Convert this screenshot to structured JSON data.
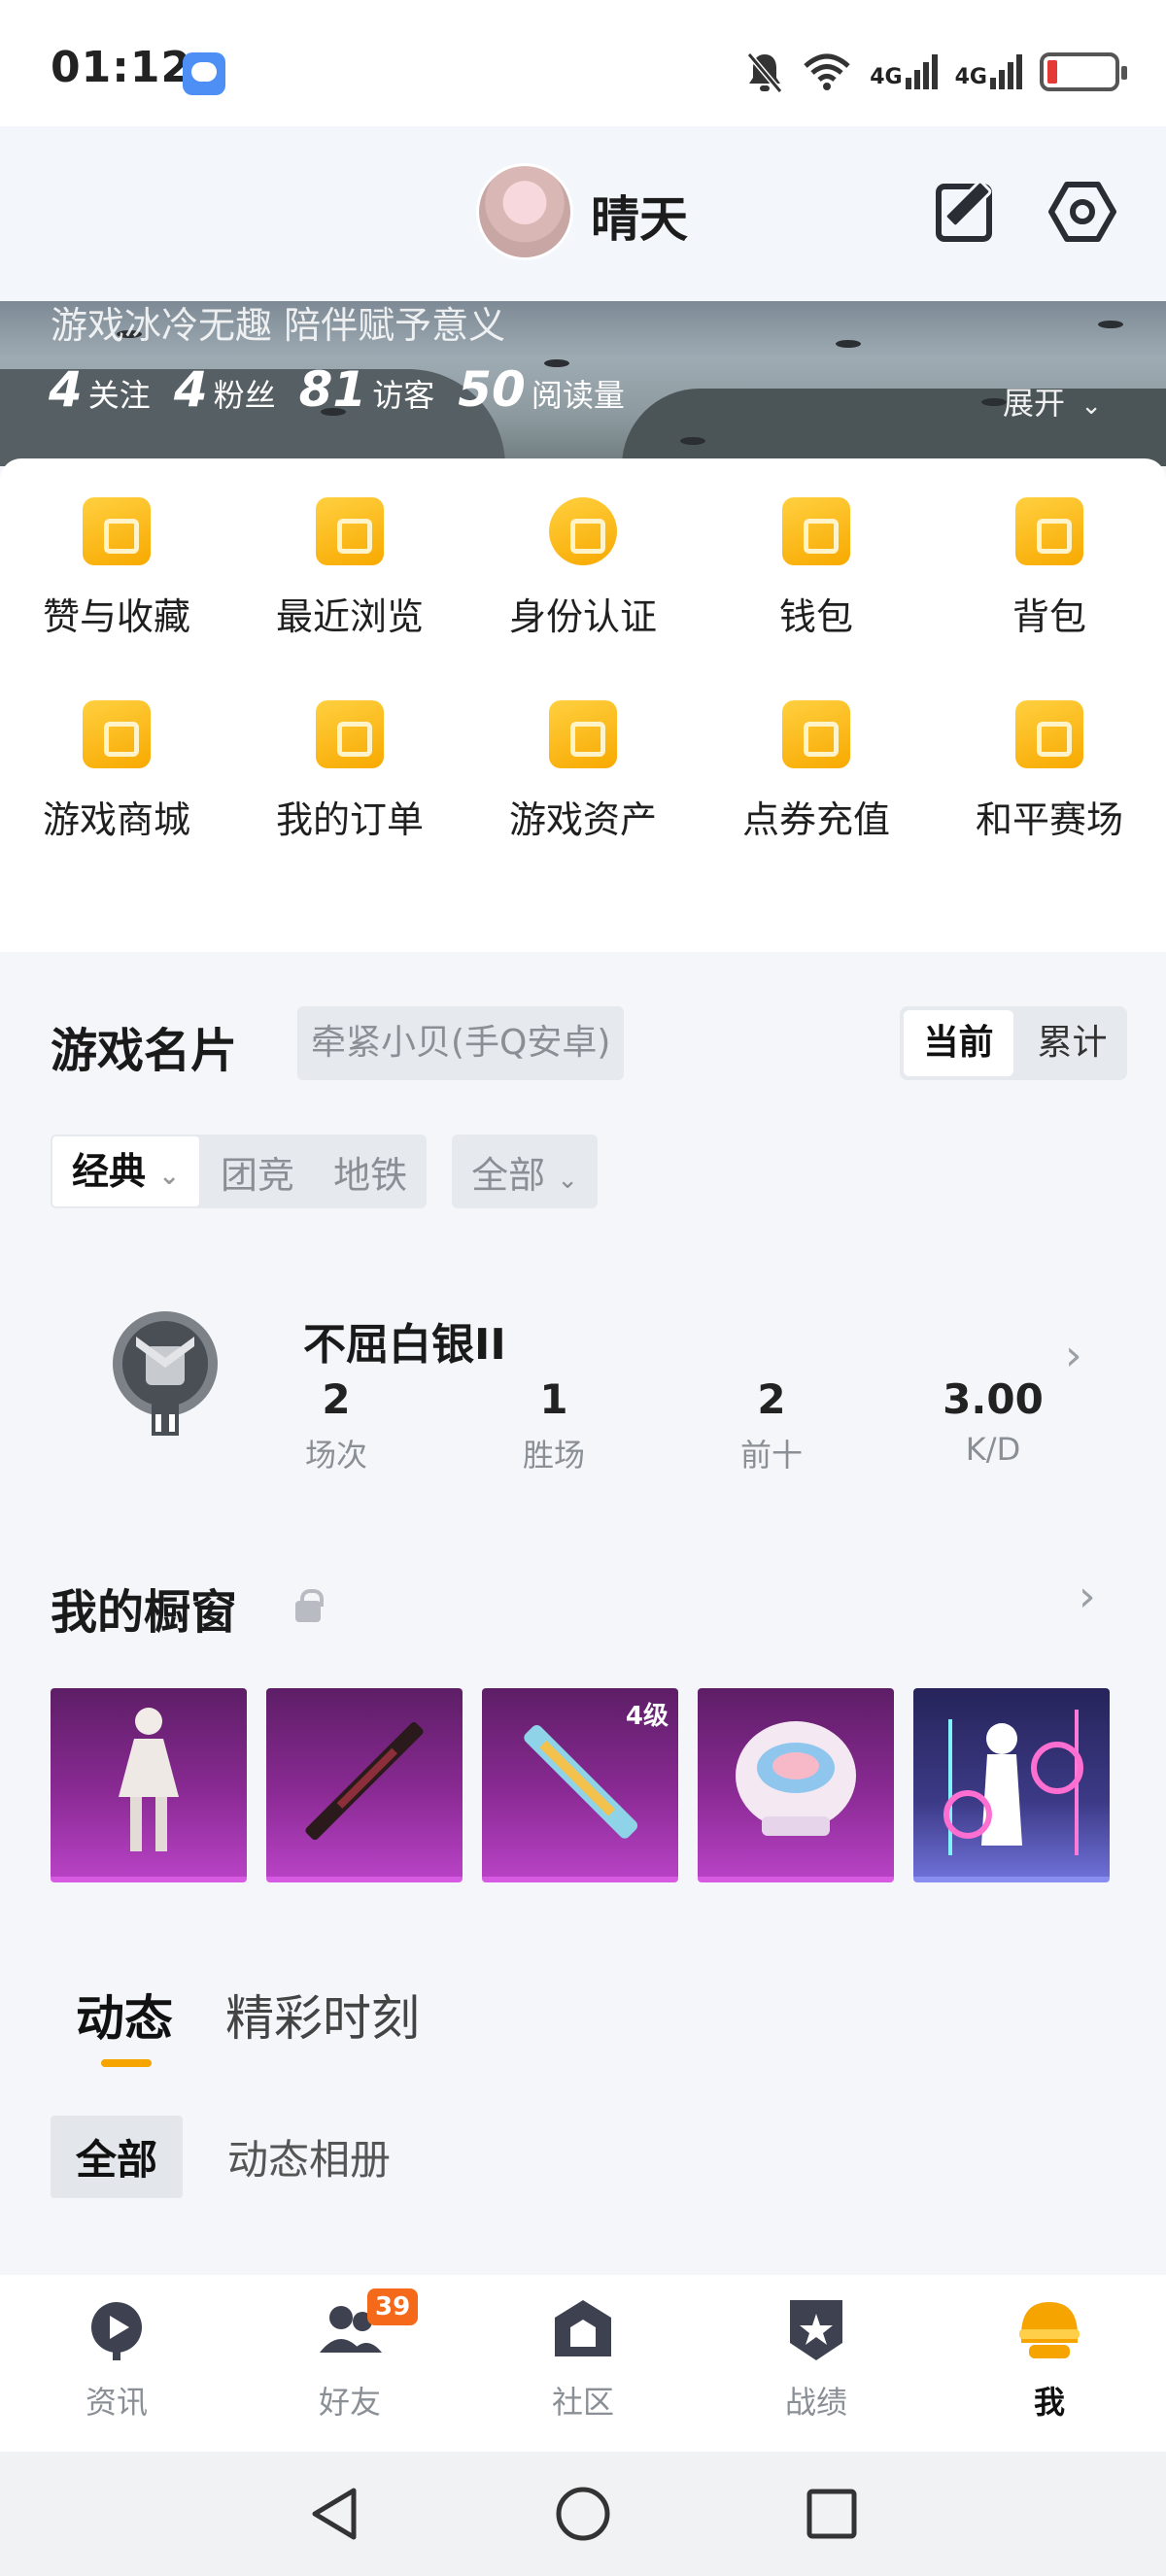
{
  "status_bar": {
    "time": "01:12",
    "signal_1": "4G",
    "signal_2": "4G"
  },
  "header": {
    "nickname": "晴天"
  },
  "profile": {
    "bio": "游戏冰冷无趣 陪伴赋予意义",
    "stats": [
      {
        "value": "4",
        "label": "关注"
      },
      {
        "value": "4",
        "label": "粉丝"
      },
      {
        "value": "81",
        "label": "访客"
      },
      {
        "value": "50",
        "label": "阅读量"
      }
    ],
    "expand_label": "展开"
  },
  "menu": {
    "items": [
      {
        "label": "赞与收藏",
        "icon": "heart-bookmark-icon"
      },
      {
        "label": "最近浏览",
        "icon": "recent-browse-icon"
      },
      {
        "label": "身份认证",
        "icon": "identity-verify-icon"
      },
      {
        "label": "钱包",
        "icon": "wallet-icon"
      },
      {
        "label": "背包",
        "icon": "backpack-icon"
      },
      {
        "label": "游戏商城",
        "icon": "game-store-icon"
      },
      {
        "label": "我的订单",
        "icon": "orders-icon"
      },
      {
        "label": "游戏资产",
        "icon": "game-assets-icon"
      },
      {
        "label": "点券充值",
        "icon": "voucher-recharge-icon"
      },
      {
        "label": "和平赛场",
        "icon": "peace-arena-icon"
      }
    ]
  },
  "game_card": {
    "title": "游戏名片",
    "account": "牵紧小贝(手Q安卓)",
    "toggle": {
      "current": "当前",
      "cumulative": "累计"
    },
    "mode_filter": "经典",
    "mode_options": [
      "团竞",
      "地铁"
    ],
    "scope_filter": "全部",
    "rank": {
      "name": "不屈白银II",
      "stats": [
        {
          "value": "2",
          "label": "场次"
        },
        {
          "value": "1",
          "label": "胜场"
        },
        {
          "value": "2",
          "label": "前十"
        },
        {
          "value": "3.00",
          "label": "K/D"
        }
      ]
    }
  },
  "showcase": {
    "title": "我的橱窗",
    "items": [
      {
        "name": "outfit-item",
        "badge": ""
      },
      {
        "name": "weapon-skin-item",
        "badge": ""
      },
      {
        "name": "rifle-skin-item",
        "badge": "4级"
      },
      {
        "name": "parachute-item",
        "badge": ""
      },
      {
        "name": "emote-item",
        "badge": ""
      }
    ]
  },
  "feed": {
    "tabs": [
      "动态",
      "精彩时刻"
    ],
    "subtabs": [
      "全部",
      "动态相册"
    ]
  },
  "bottom_nav": {
    "items": [
      {
        "label": "资讯",
        "icon": "news-icon"
      },
      {
        "label": "好友",
        "icon": "friends-icon",
        "badge": "39"
      },
      {
        "label": "社区",
        "icon": "community-icon"
      },
      {
        "label": "战绩",
        "icon": "record-icon"
      },
      {
        "label": "我",
        "icon": "me-icon",
        "active": true
      }
    ]
  },
  "colors": {
    "accent": "#f5a400",
    "badge": "#f56a1a",
    "text_secondary": "#8a8f96"
  }
}
